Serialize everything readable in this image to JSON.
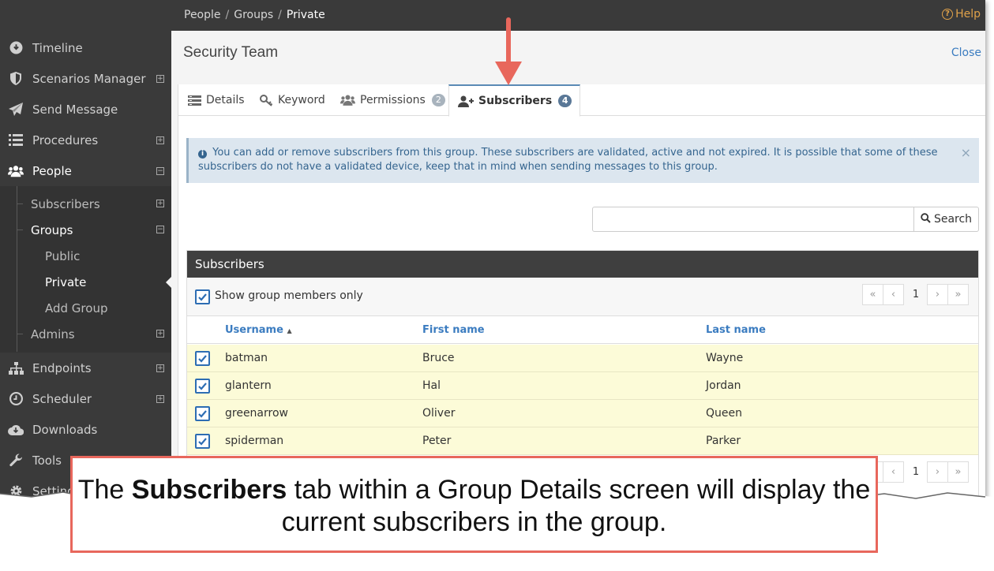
{
  "breadcrumb": {
    "items": [
      "People",
      "Groups"
    ],
    "current": "Private"
  },
  "help_label": "Help",
  "sidebar": {
    "items": [
      {
        "label": "Timeline",
        "icon": "timeline-icon"
      },
      {
        "label": "Scenarios Manager",
        "icon": "shield-icon",
        "expand": "⊞"
      },
      {
        "label": "Send Message",
        "icon": "paper-plane-icon"
      },
      {
        "label": "Procedures",
        "icon": "list-icon",
        "expand": "⊞"
      },
      {
        "label": "People",
        "icon": "users-icon",
        "expand": "⊟"
      },
      {
        "label": "Endpoints",
        "icon": "sitemap-icon",
        "expand": "⊞"
      },
      {
        "label": "Scheduler",
        "icon": "clock-icon",
        "expand": "⊞"
      },
      {
        "label": "Downloads",
        "icon": "cloud-download-icon"
      },
      {
        "label": "Tools",
        "icon": "wrench-icon"
      },
      {
        "label": "Settings",
        "icon": "gear-icon"
      }
    ],
    "people_sub": {
      "subscribers": "Subscribers",
      "groups": "Groups",
      "public": "Public",
      "private": "Private",
      "add_group": "Add Group",
      "admins": "Admins"
    }
  },
  "page": {
    "title": "Security Team",
    "close_label": "Close"
  },
  "tabs": [
    {
      "label": "Details",
      "icon": "details-icon"
    },
    {
      "label": "Keyword",
      "icon": "key-icon"
    },
    {
      "label": "Permissions",
      "icon": "group-icon",
      "badge": "2"
    },
    {
      "label": "Subscribers",
      "icon": "add-user-icon",
      "badge": "4"
    }
  ],
  "info": {
    "text": "You can add or remove subscribers from this group. These subscribers are validated, active and not expired. It is possible that some of these subscribers do not have a validated device, keep that in mind when sending messages to this group.",
    "close": "×"
  },
  "search": {
    "value": "",
    "button_label": "Search"
  },
  "subscribers_panel": {
    "title": "Subscribers",
    "show_members_label": "Show group members only",
    "show_members_checked": true,
    "pager": {
      "first": "«",
      "prev": "‹",
      "page": "1",
      "next": "›",
      "last": "»"
    },
    "columns": {
      "username": "Username",
      "sort_indicator": "▲",
      "first_name": "First name",
      "last_name": "Last name"
    },
    "rows": [
      {
        "username": "batman",
        "first_name": "Bruce",
        "last_name": "Wayne",
        "checked": true
      },
      {
        "username": "glantern",
        "first_name": "Hal",
        "last_name": "Jordan",
        "checked": true
      },
      {
        "username": "greenarrow",
        "first_name": "Oliver",
        "last_name": "Queen",
        "checked": true
      },
      {
        "username": "spiderman",
        "first_name": "Peter",
        "last_name": "Parker",
        "checked": true
      }
    ]
  },
  "caption": {
    "prefix": "The ",
    "bold": "Subscribers",
    "rest": " tab within a Group Details screen will display the current subscribers in the group."
  },
  "colors": {
    "accent": "#3b7cc0",
    "arrow": "#e8675c",
    "row_highlight": "#fcfbd8",
    "sidebar": "#3a3a3a"
  }
}
